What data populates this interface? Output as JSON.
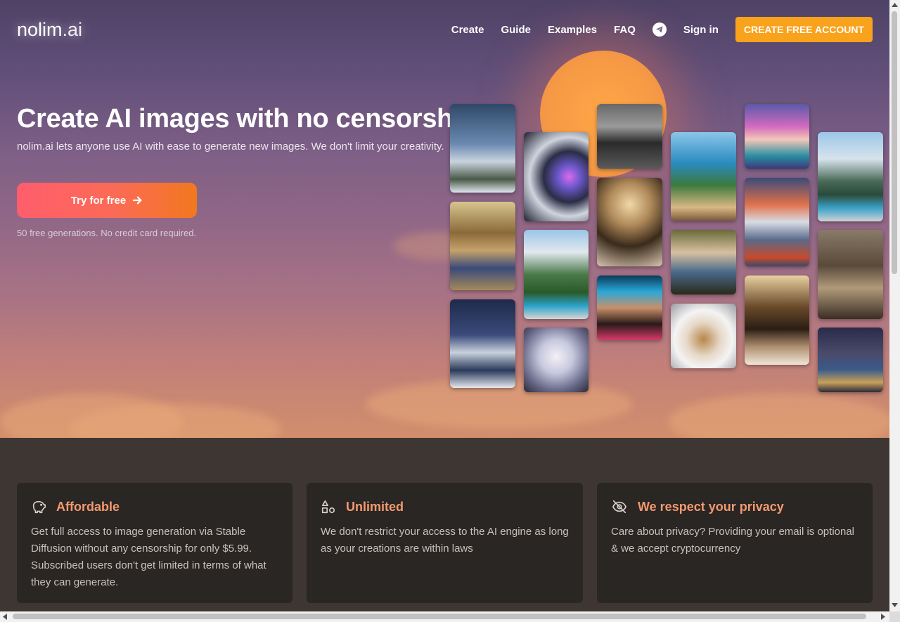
{
  "logo": {
    "brand": "nolim",
    "domain": ".ai"
  },
  "nav": {
    "links": [
      "Create",
      "Guide",
      "Examples",
      "FAQ"
    ],
    "signin": "Sign in",
    "cta": "CREATE FREE ACCOUNT"
  },
  "hero": {
    "title": "Create AI images with no censorship",
    "subtitle": "nolim.ai lets anyone use AI with ease to generate new images. We don't limit your creativity.",
    "button": "Try for free",
    "note": "50 free generations. No credit card required."
  },
  "gallery": [
    "mountain-starburst",
    "robot-woman",
    "suited-man-city",
    "lake-villa",
    "pink-hair-girl",
    "glass-house",
    "monkey-family-portrait",
    "glass-house-pool",
    "chandelier-lobby",
    "renaissance-woman",
    "red-mountains",
    "monkey-group",
    "snowy-peaks",
    "neon-bearded-man",
    "luxury-hallway",
    "white-hair-woman",
    "puppy-bunny-hat",
    "city-night"
  ],
  "features": [
    {
      "icon": "piggy-bank-icon",
      "title": "Affordable",
      "text": "Get full access to image generation via Stable Diffusion without any censorship for only $5.99. Subscribed users don't get limited in terms of what they can generate."
    },
    {
      "icon": "shapes-icon",
      "title": "Unlimited",
      "text": "We don't restrict your access to the AI engine as long as your creations are within laws"
    },
    {
      "icon": "eye-slash-icon",
      "title": "We respect your privacy",
      "text": "Care about privacy? Providing your email is optional & we accept cryptocurrency"
    }
  ],
  "colors": {
    "cta": "#f9a21b",
    "accent": "#f4996f",
    "card": "#2a2624"
  }
}
